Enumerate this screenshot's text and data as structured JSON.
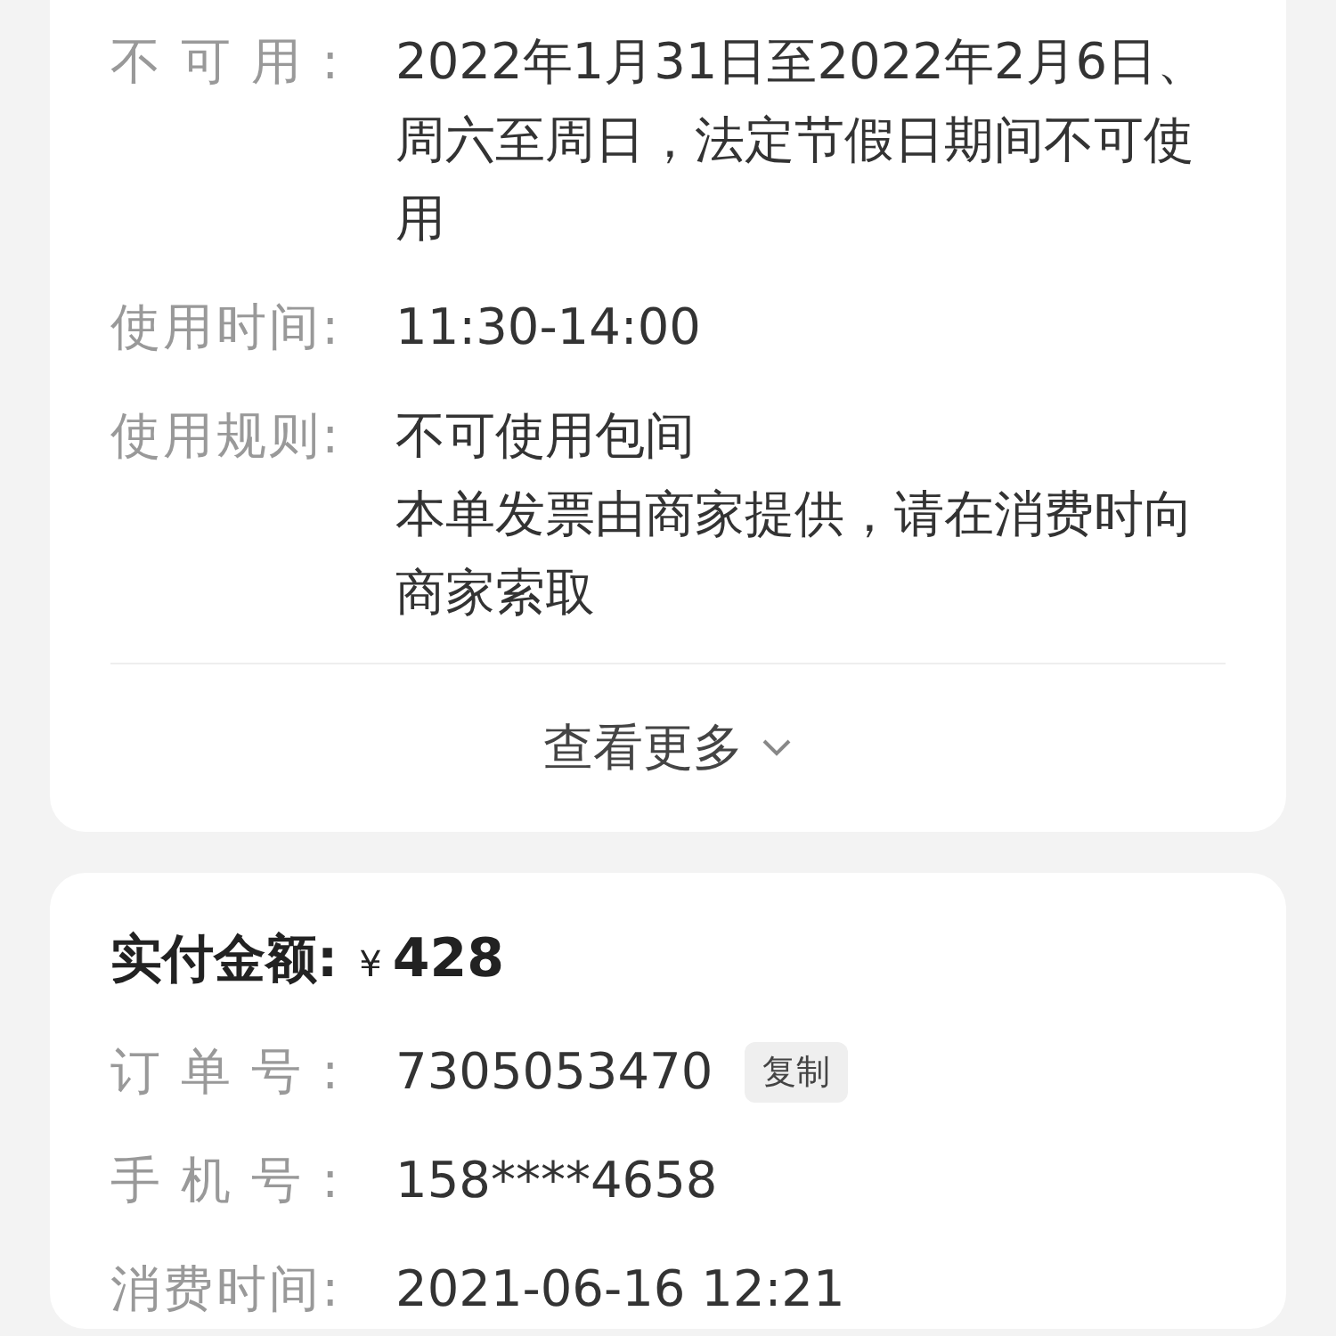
{
  "rules_card": {
    "rows": [
      {
        "label": "不可用:",
        "paragraphs": [
          [
            "2022年1月31日至2022年2月6日、",
            "周六至周日，法定节假日期间不可使用"
          ]
        ]
      },
      {
        "label": "使用时间:",
        "paragraphs": [
          [
            "11:30-14:00"
          ]
        ]
      },
      {
        "label": "使用规则:",
        "paragraphs": [
          [
            "不可使用包间"
          ],
          [
            "本单发票由商家提供，请在消费时向商家索取"
          ]
        ]
      }
    ],
    "more_link": "查看更多"
  },
  "order_card": {
    "paid_label": "实付金额:",
    "currency": "¥",
    "amount": "428",
    "rows": [
      {
        "label": "订单号:",
        "value": "7305053470",
        "action": "复制"
      },
      {
        "label": "手机号:",
        "value": "158****4658"
      },
      {
        "label": "消费时间:",
        "value": "2021-06-16 12:21"
      }
    ]
  }
}
